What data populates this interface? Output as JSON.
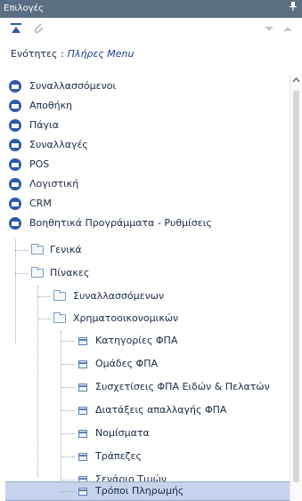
{
  "panel": {
    "title": "Επιλογές",
    "pin_icon": "pin-icon"
  },
  "toolbar": {
    "icons": [
      "collapse-all-icon",
      "attach-icon",
      "arrow-down-icon",
      "arrow-up-icon"
    ]
  },
  "sections": {
    "label": "Ενότητες :",
    "value": "Πλήρες Menu"
  },
  "tree": {
    "top_items": [
      "Συναλλασσόμενοι",
      "Αποθήκη",
      "Πάγια",
      "Συναλλαγές",
      "POS",
      "Λογιστική",
      "CRM",
      "Βοηθητικά Προγράμματα - Ρυθμίσεις"
    ],
    "level1": [
      "Γενικά",
      "Πίνακες"
    ],
    "level2": [
      "Συναλλασσόμενων",
      "Χρηματοοικονομικών"
    ],
    "level3": [
      "Κατηγορίες ΦΠΑ",
      "Ομάδες ΦΠΑ",
      "Συσχετίσεις ΦΠΑ Ειδών & Πελατών",
      "Διατάξεις απαλλαγής ΦΠΑ",
      "Νομίσματα",
      "Τράπεζες",
      "Σενάριο Τιμών",
      "Τρόποι Πληρωμής"
    ],
    "selected": "Τρόποι Πληρωμής"
  },
  "colors": {
    "titlebar": "#5b6f84",
    "bullet": "#2e5aa8",
    "selection": "#c6d3ec"
  }
}
